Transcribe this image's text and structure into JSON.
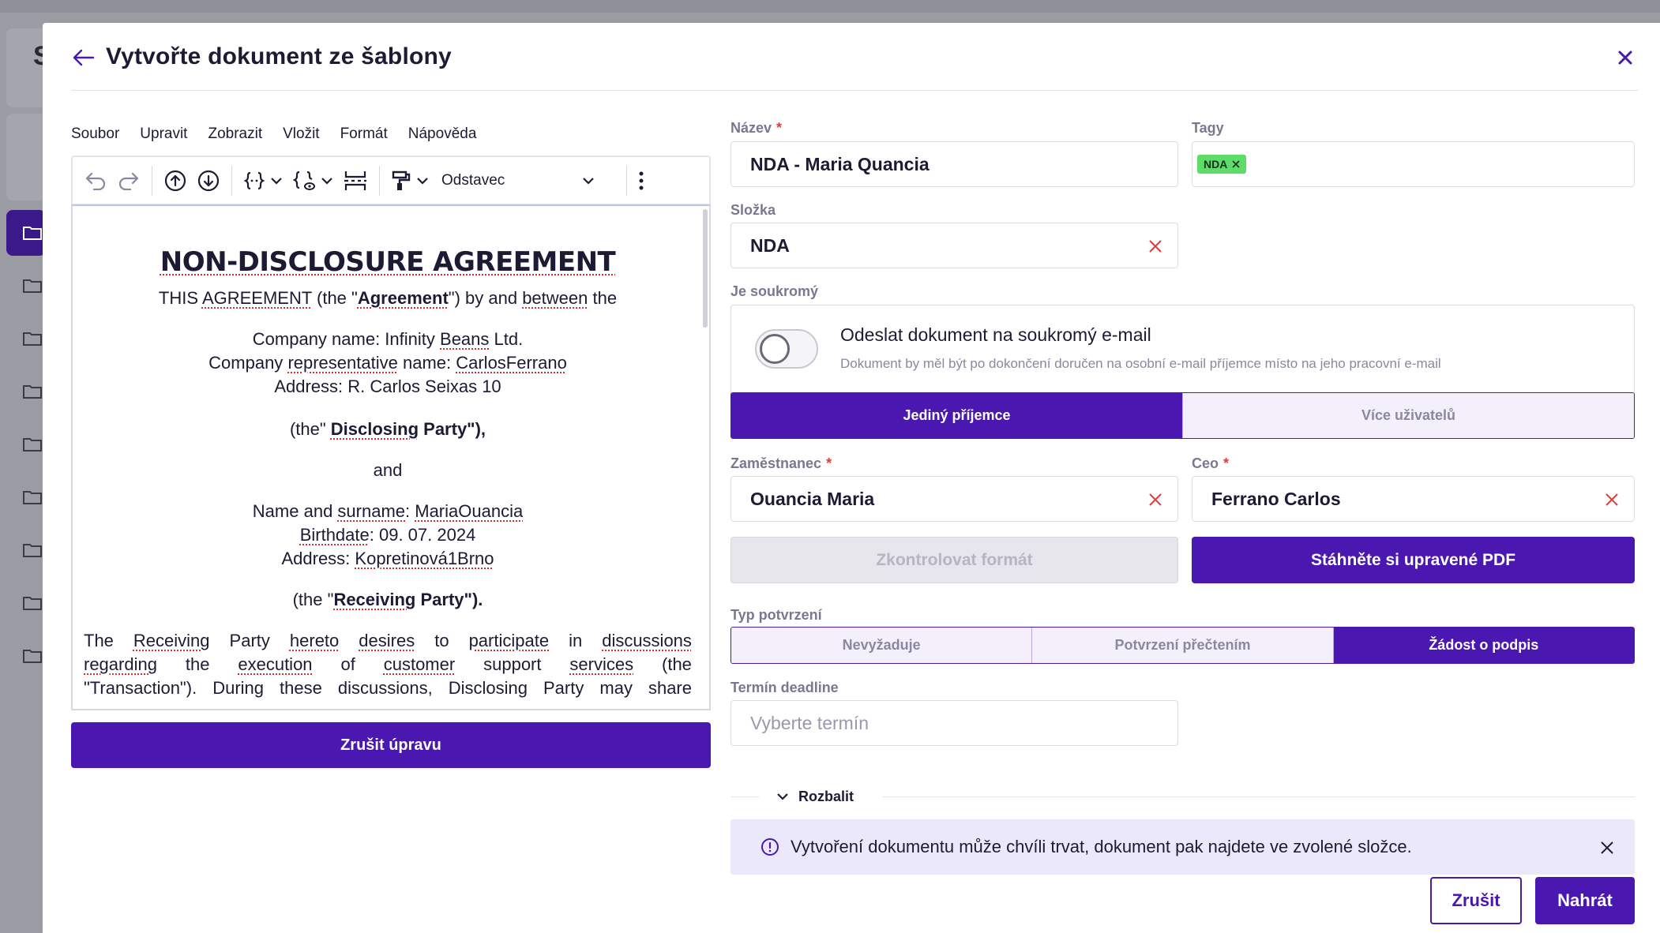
{
  "background": {
    "sidebar_letter": "S"
  },
  "modal": {
    "title": "Vytvořte dokument ze šablony"
  },
  "editor": {
    "menu": [
      "Soubor",
      "Upravit",
      "Zobrazit",
      "Vložit",
      "Formát",
      "Nápověda"
    ],
    "block_format": "Odstavec",
    "document": {
      "heading": "NON-DISCLOSURE AGREEMENT",
      "intro_a": "THIS ",
      "intro_agreement": "AGREEMENT",
      "intro_b": " (the \"",
      "intro_bold": "Agreement",
      "intro_c": "\") by and ",
      "intro_between": "between",
      "intro_d": " the",
      "company_name_a": "Company name: Infinity ",
      "company_name_b": "Beans",
      "company_name_c": " Ltd.",
      "company_rep_a": "Company ",
      "company_rep_b": "representative",
      "company_rep_c": " name: ",
      "company_rep_d": "CarlosFerrano",
      "company_address": "Address: R. Carlos Seixas 10",
      "disclosing_a": "(the\" ",
      "disclosing_b": "Disclosing",
      "disclosing_c": " Party\"),",
      "and": "and",
      "name_a": "Name and ",
      "name_b": "surname",
      "name_c": ": ",
      "name_d": "MariaOuancia",
      "birth_a": "Birthdate",
      "birth_b": ": 09. 07. 2024",
      "address_a": "Address: ",
      "address_b": "Kopretinová1Brno",
      "receiving_a": "(the \"",
      "receiving_b": "Receiving",
      "receiving_c": " Party\").",
      "para1": [
        "The",
        "Receiving",
        "Party",
        "hereto",
        "desires",
        "to",
        "participate",
        "in",
        "discussions"
      ],
      "para2": [
        "regarding",
        "the",
        "execution",
        "of",
        "customer",
        "support",
        "services",
        "(the"
      ],
      "para3": "\"Transaction\"). During these discussions, Disclosing Party may share"
    },
    "cancel_edit_label": "Zrušit úpravu"
  },
  "form": {
    "name_label": "Název",
    "name_value": "NDA - Maria Quancia",
    "tags_label": "Tagy",
    "tags": [
      "NDA"
    ],
    "folder_label": "Složka",
    "folder_value": "NDA",
    "private_label": "Je soukromý",
    "private_title": "Odeslat dokument na soukromý e-mail",
    "private_desc": "Dokument by měl být po dokončení doručen na osobní e-mail příjemce místo na jeho pracovní e-mail",
    "recipient_modes": [
      "Jediný příjemce",
      "Více uživatelů"
    ],
    "employee_label": "Zaměstnanec",
    "employee_value": "Ouancia Maria",
    "ceo_label": "Ceo",
    "ceo_value": "Ferrano Carlos",
    "check_format_label": "Zkontrolovat formát",
    "download_pdf_label": "Stáhněte si upravené PDF",
    "confirm_type_label": "Typ potvrzení",
    "confirm_types": [
      "Nevyžaduje",
      "Potvrzení přečtením",
      "Žádost o podpis"
    ],
    "deadline_label": "Termín deadline",
    "deadline_placeholder": "Vyberte termín",
    "expand_label": "Rozbalit",
    "info_text": "Vytvoření dokumentu může chvíli trvat, dokument pak najdete ve zvolené složce.",
    "cancel_label": "Zrušit",
    "upload_label": "Nahrát"
  },
  "colors": {
    "primary": "#4a17b0",
    "tag": "#5ddc6a",
    "danger": "#e03a3a"
  }
}
